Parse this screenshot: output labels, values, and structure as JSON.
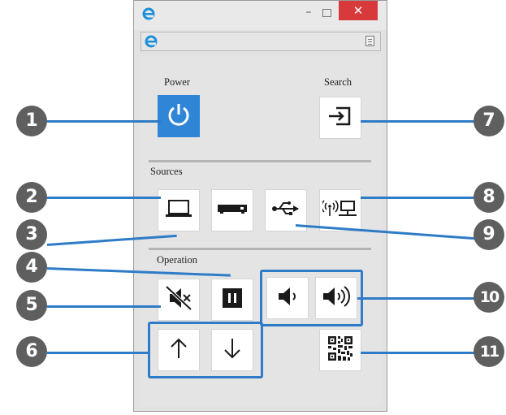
{
  "labels": {
    "power": "Power",
    "search": "Search",
    "sources": "Sources",
    "operation": "Operation"
  },
  "window": {
    "minimize_symbol": "–",
    "close_symbol": "✕"
  },
  "callouts": [
    "1",
    "2",
    "3",
    "4",
    "5",
    "6",
    "7",
    "8",
    "9",
    "10",
    "11"
  ],
  "icons": {
    "power": "power-icon",
    "search": "source-search-icon",
    "computer": "computer-source-icon",
    "video": "video-source-icon",
    "usb": "usb-source-icon",
    "network": "network-source-icon",
    "av_mute": "av-mute-icon",
    "freeze": "freeze-icon",
    "volume_down": "volume-down-icon",
    "volume_up": "volume-up-icon",
    "page_up": "page-up-icon",
    "page_down": "page-down-icon",
    "qr": "qr-code-icon"
  },
  "colors": {
    "accent": "#2e7cc7",
    "power_button": "#2f86d6",
    "close_button": "#d8393b",
    "callout": "#5f5f5f"
  }
}
